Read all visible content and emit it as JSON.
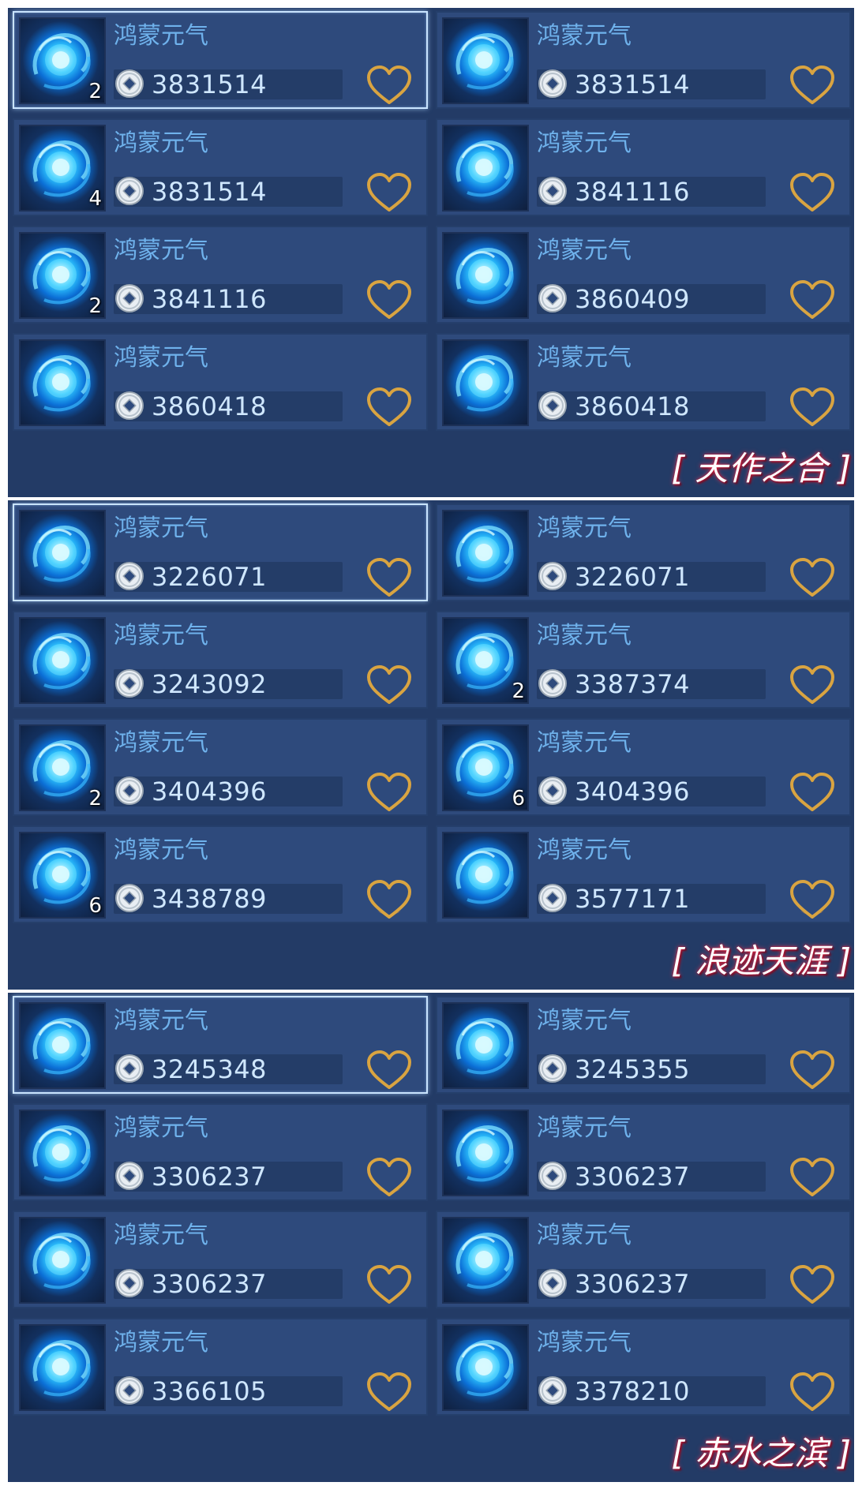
{
  "item_name": "鸿蒙元气",
  "icon": "swirl-orb-icon",
  "coin_icon": "silver-coin-icon",
  "heart_icon": "heart-icon",
  "colors": {
    "panel_bg": "#233b66",
    "card_bg": "#2e4a7c",
    "name_color": "#6fb2ec",
    "price_color": "#cfe7ff",
    "heart_gold": "#d9a441",
    "tag_glow": "#ff3c5a"
  },
  "sections": [
    {
      "tag": "[ 天作之合 ]",
      "items": [
        {
          "name": "鸿蒙元气",
          "price": "3831514",
          "count": "2",
          "selected": true
        },
        {
          "name": "鸿蒙元气",
          "price": "3831514",
          "count": ""
        },
        {
          "name": "鸿蒙元气",
          "price": "3831514",
          "count": "4"
        },
        {
          "name": "鸿蒙元气",
          "price": "3841116",
          "count": ""
        },
        {
          "name": "鸿蒙元气",
          "price": "3841116",
          "count": "2"
        },
        {
          "name": "鸿蒙元气",
          "price": "3860409",
          "count": ""
        },
        {
          "name": "鸿蒙元气",
          "price": "3860418",
          "count": ""
        },
        {
          "name": "鸿蒙元气",
          "price": "3860418",
          "count": ""
        }
      ]
    },
    {
      "tag": "[ 浪迹天涯 ]",
      "items": [
        {
          "name": "鸿蒙元气",
          "price": "3226071",
          "count": "",
          "selected": true
        },
        {
          "name": "鸿蒙元气",
          "price": "3226071",
          "count": ""
        },
        {
          "name": "鸿蒙元气",
          "price": "3243092",
          "count": ""
        },
        {
          "name": "鸿蒙元气",
          "price": "3387374",
          "count": "2"
        },
        {
          "name": "鸿蒙元气",
          "price": "3404396",
          "count": "2"
        },
        {
          "name": "鸿蒙元气",
          "price": "3404396",
          "count": "6"
        },
        {
          "name": "鸿蒙元气",
          "price": "3438789",
          "count": "6",
          "heart_filled": true
        },
        {
          "name": "鸿蒙元气",
          "price": "3577171",
          "count": "",
          "heart_filled": true
        }
      ]
    },
    {
      "tag": "[ 赤水之滨 ]",
      "items": [
        {
          "name": "鸿蒙元气",
          "price": "3245348",
          "count": "",
          "selected": true
        },
        {
          "name": "鸿蒙元气",
          "price": "3245355",
          "count": ""
        },
        {
          "name": "鸿蒙元气",
          "price": "3306237",
          "count": "",
          "heart_filled": true
        },
        {
          "name": "鸿蒙元气",
          "price": "3306237",
          "count": ""
        },
        {
          "name": "鸿蒙元气",
          "price": "3306237",
          "count": ""
        },
        {
          "name": "鸿蒙元气",
          "price": "3306237",
          "count": ""
        },
        {
          "name": "鸿蒙元气",
          "price": "3366105",
          "count": ""
        },
        {
          "name": "鸿蒙元气",
          "price": "3378210",
          "count": ""
        }
      ]
    }
  ]
}
